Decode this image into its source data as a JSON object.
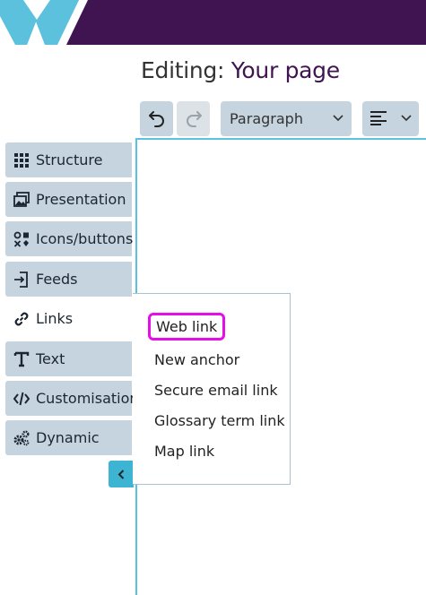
{
  "header": {
    "logo_color": "#5bc1dc",
    "bar_color": "#3f1450",
    "title_prefix": "Editing:",
    "title_page": "Your page"
  },
  "toolbar": {
    "undo_icon": "undo-icon",
    "redo_icon": "redo-icon",
    "block_format": "Paragraph",
    "align_icon": "align-left-icon"
  },
  "sidebar": {
    "items": [
      {
        "label": "Structure",
        "icon": "grid-icon"
      },
      {
        "label": "Presentation",
        "icon": "images-icon"
      },
      {
        "label": "Icons/buttons",
        "icon": "icons-buttons-icon"
      },
      {
        "label": "Feeds",
        "icon": "feed-import-icon"
      },
      {
        "label": "Links",
        "icon": "link-icon",
        "active": true
      },
      {
        "label": "Text",
        "icon": "text-icon"
      },
      {
        "label": "Customisation",
        "icon": "code-icon"
      },
      {
        "label": "Dynamic",
        "icon": "cogs-icon"
      }
    ],
    "collapse_icon": "chevron-left-icon"
  },
  "links_menu": {
    "items": [
      "Web link",
      "New anchor",
      "Secure email link",
      "Glossary term link",
      "Map link"
    ],
    "highlighted": "Web link",
    "highlight_color": "#e60ee6"
  },
  "colors": {
    "accent": "#3cb4d2",
    "tab_bg": "#c5d4de"
  }
}
